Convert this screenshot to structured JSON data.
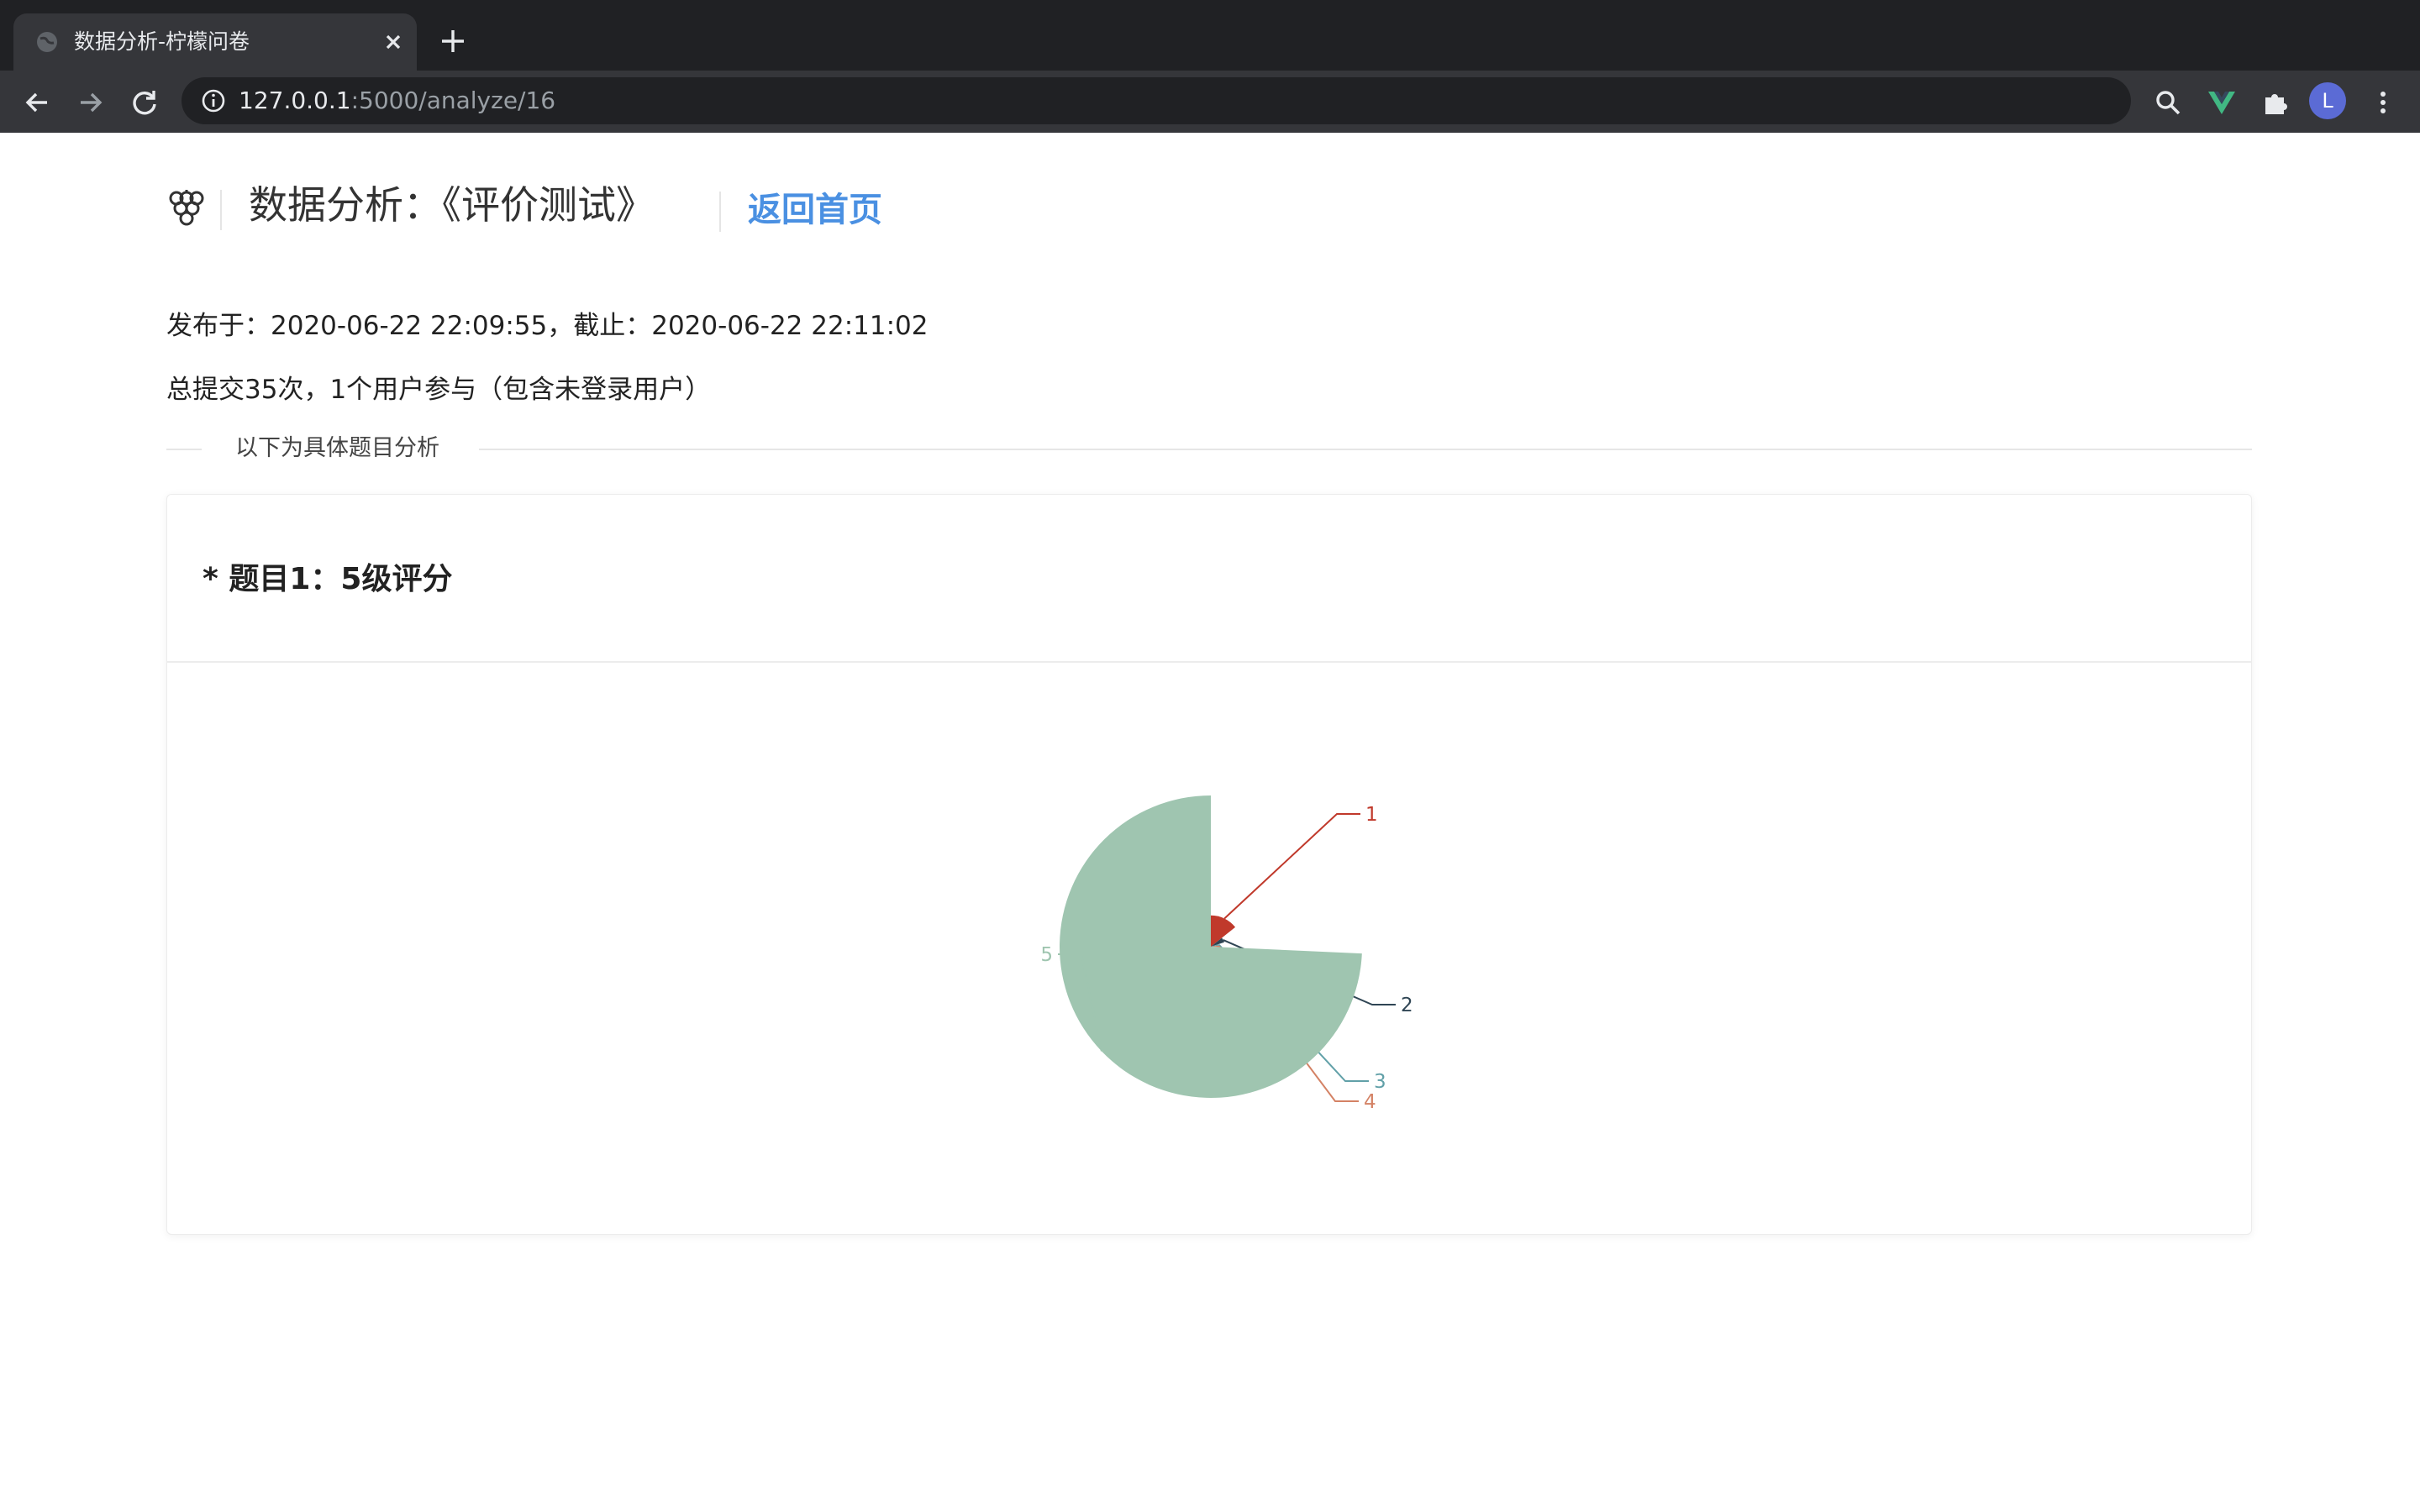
{
  "browser": {
    "tab_title": "数据分析-柠檬问卷",
    "url_host": "127.0.0.1",
    "url_rest": ":5000/analyze/16",
    "avatar_letter": "L"
  },
  "header": {
    "title": "数据分析：《评价测试》",
    "back_link": "返回首页",
    "link_color": "#4a90e2"
  },
  "info": {
    "published": "发布于：2020-06-22 22:09:55，截止：2020-06-22 22:11:02",
    "summary": "总提交35次，1个用户参与（包含未登录用户）"
  },
  "divider_label": "以下为具体题目分析",
  "question": {
    "title": "* 题目1：5级评分"
  },
  "chart_data": {
    "type": "pie",
    "rose_type": "radius",
    "title": "",
    "series": [
      {
        "name": "1",
        "value": 5,
        "color": "#c0392b"
      },
      {
        "name": "2",
        "value": 2,
        "color": "#2f4554"
      },
      {
        "name": "3",
        "value": 1,
        "color": "#61a0a8"
      },
      {
        "name": "4",
        "value": 1,
        "color": "#d48265"
      },
      {
        "name": "5",
        "value": 26,
        "color": "#9fc5b0"
      }
    ]
  }
}
